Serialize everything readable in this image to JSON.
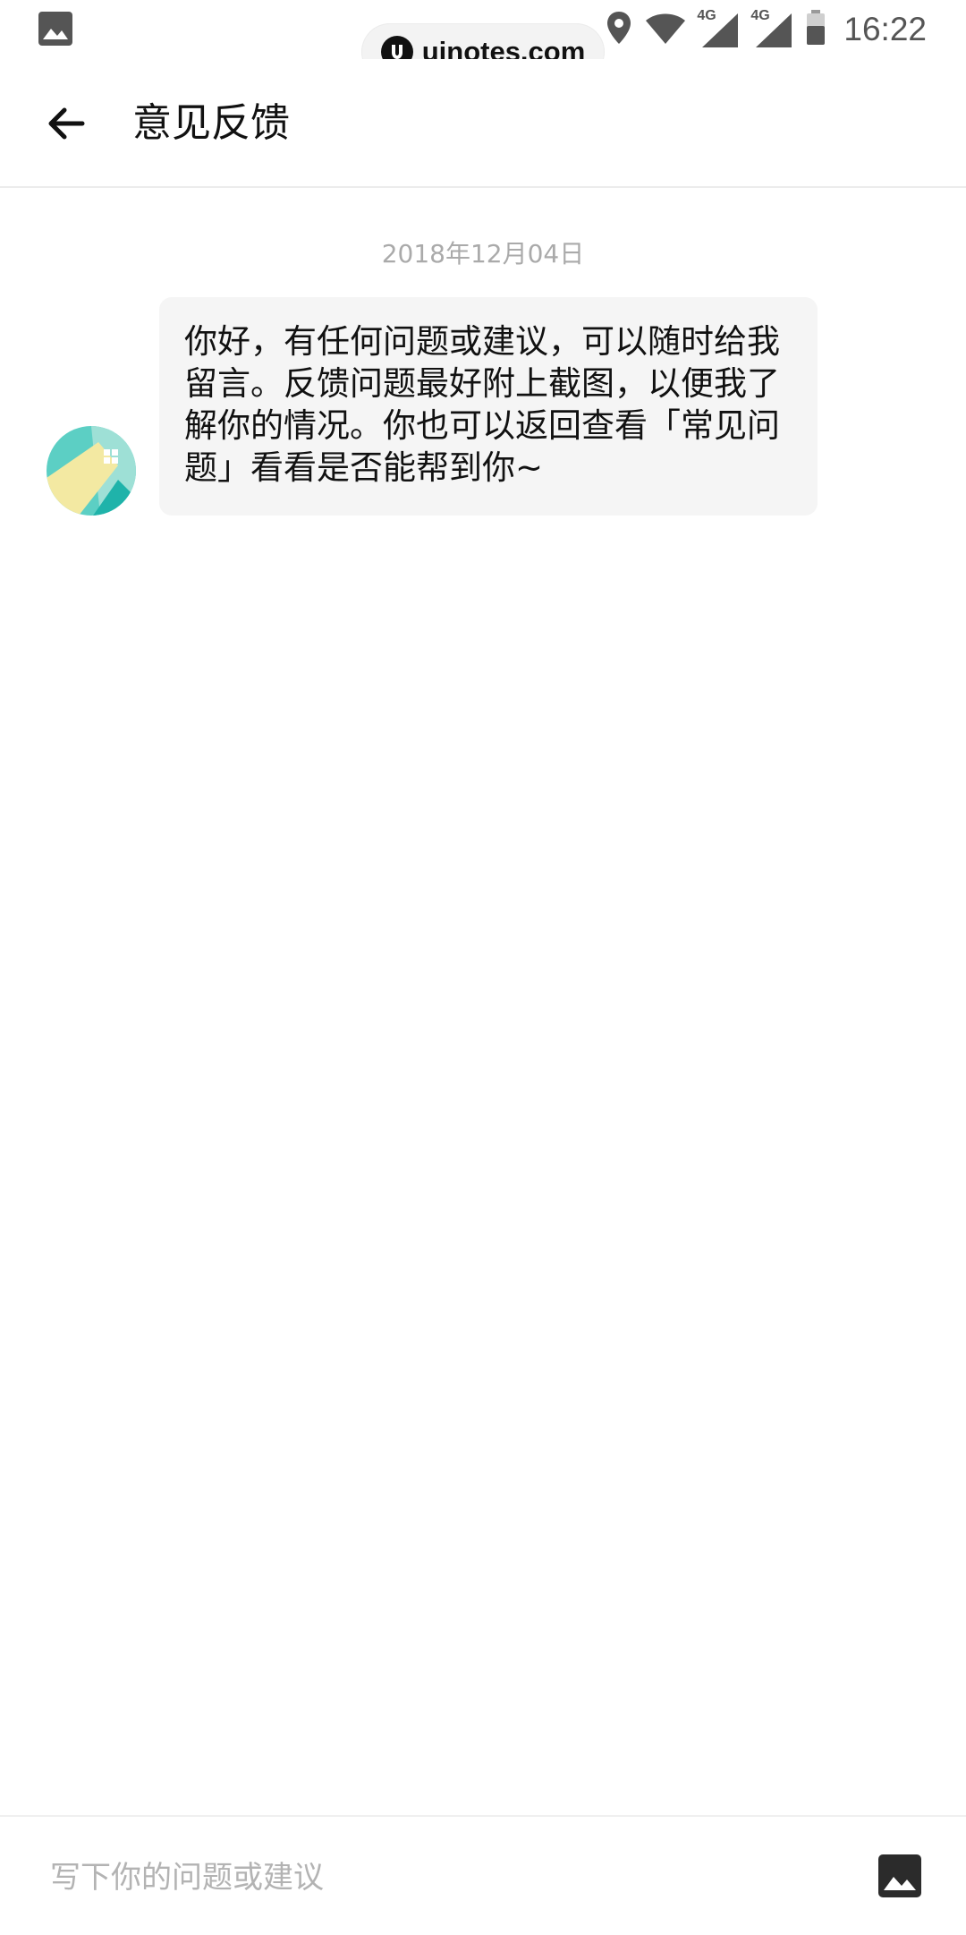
{
  "status_bar": {
    "time": "16:22",
    "signal_1_label": "4G",
    "signal_2_label": "4G",
    "icons": [
      "image-icon",
      "location-icon",
      "wifi-icon",
      "cell-signal-icon",
      "cell-signal-icon",
      "battery-icon"
    ]
  },
  "watermark": {
    "text": "uinotes.com"
  },
  "header": {
    "back_icon": "arrow-left-icon",
    "title": "意见反馈"
  },
  "conversation": {
    "date": "2018年12月04日",
    "messages": [
      {
        "sender": "support",
        "text": "你好，有任何问题或建议，可以随时给我留言。反馈问题最好附上截图，以便我了解你的情况。你也可以返回查看「常见问题」看看是否能帮到你~"
      }
    ]
  },
  "input_bar": {
    "placeholder": "写下你的问题或建议",
    "value": "",
    "image_icon": "image-icon"
  },
  "colors": {
    "bubble_bg": "#f5f5f5",
    "date_text": "#aaaaaa",
    "avatar_teal": "#5ccfc4",
    "avatar_yellow": "#f3e9a2",
    "avatar_dark_teal": "#1fb3aa"
  }
}
